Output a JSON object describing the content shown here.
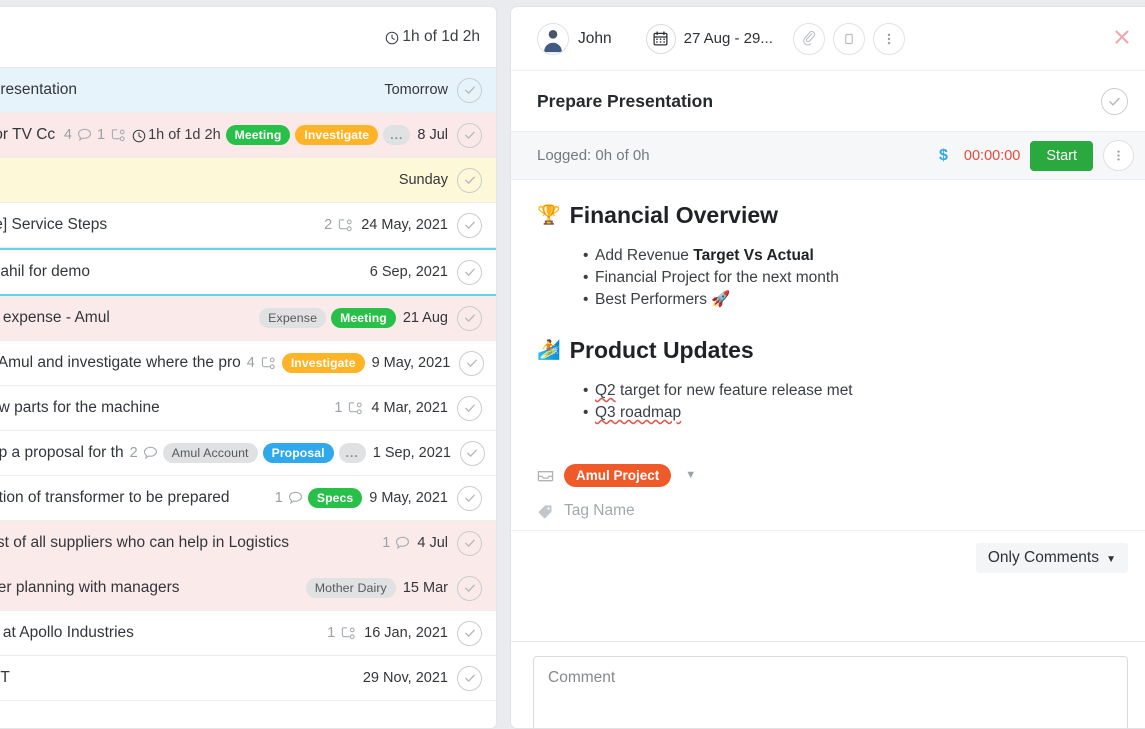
{
  "list_panel": {
    "header": {
      "time_summary": "1h of 1d 2h"
    },
    "rows": [
      {
        "title": "Presentation",
        "date": "Tomorrow",
        "style": "sel",
        "comments": "",
        "subtasks": "",
        "time": "",
        "tags": []
      },
      {
        "title": "for TV Cc",
        "date": "8 Jul",
        "style": "pink",
        "comments": "4",
        "subtasks": "1",
        "time": "1h of 1d 2h",
        "tags": [
          {
            "label": "Meeting",
            "color": "green"
          },
          {
            "label": "Investigate",
            "color": "orange"
          },
          {
            "label": "...",
            "color": "dots"
          }
        ]
      },
      {
        "title": "",
        "date": "Sunday",
        "style": "yellow",
        "comments": "",
        "subtasks": "",
        "time": "",
        "tags": []
      },
      {
        "title": "te] Service Steps",
        "date": "24 May, 2021",
        "style": "",
        "comments": "",
        "subtasks": "2",
        "time": "",
        "tags": []
      },
      {
        "title": "Sahil for demo",
        "date": "6 Sep, 2021",
        "style": "dropzone",
        "comments": "",
        "subtasks": "",
        "time": "",
        "tags": []
      },
      {
        "title": "g expense - Amul",
        "date": "21 Aug",
        "style": "pink2",
        "comments": "",
        "subtasks": "",
        "time": "",
        "tags": [
          {
            "label": "Expense",
            "color": "grey"
          },
          {
            "label": "Meeting",
            "color": "green"
          }
        ]
      },
      {
        "title": "t Amul and investigate where the pro",
        "date": "9 May, 2021",
        "style": "",
        "comments": "",
        "subtasks": "4",
        "time": "",
        "tags": [
          {
            "label": "Investigate",
            "color": "orange"
          }
        ]
      },
      {
        "title": "ew parts for the machine",
        "date": "4 Mar, 2021",
        "style": "",
        "comments": "",
        "subtasks": "1",
        "time": "",
        "tags": []
      },
      {
        "title": "up a proposal for th",
        "date": "1 Sep, 2021",
        "style": "",
        "comments": "2",
        "subtasks": "",
        "time": "",
        "tags": [
          {
            "label": "Amul Account",
            "color": "grey"
          },
          {
            "label": "Proposal",
            "color": "blue"
          },
          {
            "label": "...",
            "color": "dots"
          }
        ]
      },
      {
        "title": "ation of transformer to be prepared",
        "date": "9 May, 2021",
        "style": "",
        "comments": "1",
        "subtasks": "",
        "time": "",
        "tags": [
          {
            "label": "Specs",
            "color": "green"
          }
        ]
      },
      {
        "title": "list of all suppliers who can help in Logistics",
        "date": "4 Jul",
        "style": "pink2",
        "comments": "1",
        "subtasks": "",
        "time": "",
        "tags": []
      },
      {
        "title": "ver planning with managers",
        "date": "15 Mar",
        "style": "pink2",
        "comments": "",
        "subtasks": "",
        "time": "",
        "tags": [
          {
            "label": "Mother Dairy",
            "color": "grey"
          }
        ]
      },
      {
        "title": "g at Apollo Industries",
        "date": "16 Jan, 2021",
        "style": "",
        "comments": "",
        "subtasks": "1",
        "time": "",
        "tags": []
      },
      {
        "title": "PT",
        "date": "29 Nov, 2021",
        "style": "",
        "comments": "",
        "subtasks": "",
        "time": "",
        "tags": []
      }
    ]
  },
  "detail_panel": {
    "assignee": "John",
    "date_range": "27 Aug - 29...",
    "title": "Prepare Presentation",
    "logged": "Logged: 0h of 0h",
    "timer": "00:00:00",
    "start_label": "Start",
    "sections": [
      {
        "emoji": "🏆",
        "heading": "Financial Overview",
        "bullets": [
          {
            "pre": "Add Revenue ",
            "bold": "Target Vs Actual",
            "post": ""
          },
          {
            "pre": "Financial Project for the next month",
            "bold": "",
            "post": ""
          },
          {
            "pre": "Best Performers ",
            "bold": "",
            "post": "🚀"
          }
        ]
      },
      {
        "emoji": "🏄",
        "heading": "Product Updates",
        "bullets": [
          {
            "pre": "",
            "spell": "Q2",
            "post": " target for new feature release met"
          },
          {
            "pre": "",
            "spell": "Q3 roadmap",
            "post": ""
          }
        ]
      }
    ],
    "project_tag": "Amul Project",
    "tag_placeholder": "Tag Name",
    "filter_label": "Only Comments",
    "comment_placeholder": "Comment"
  },
  "colors": {
    "accent_green": "#2aa93f",
    "accent_orange": "#f05a28",
    "timer_red": "#e8483c",
    "tag_blue": "#2fa8ec",
    "selected_row": "#e7f3fb",
    "dropzone": "#63d4e8"
  }
}
